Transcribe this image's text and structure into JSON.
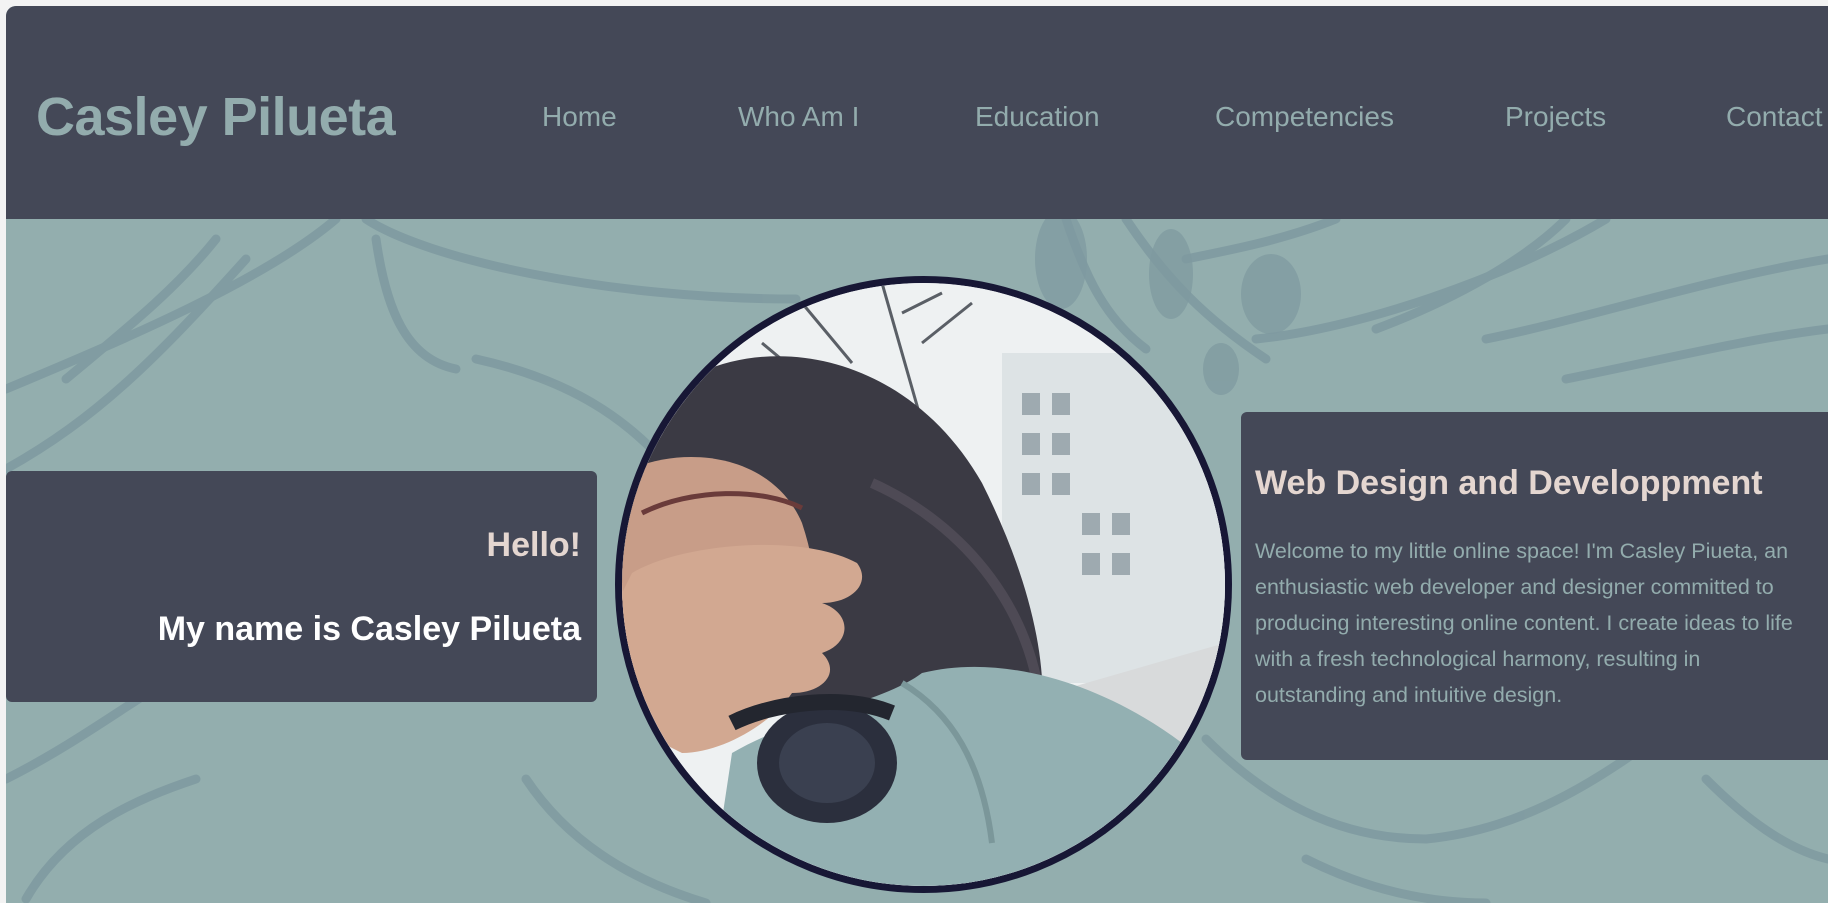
{
  "header": {
    "brand": "Casley Pilueta",
    "nav": [
      {
        "label": "Home"
      },
      {
        "label": "Who Am I"
      },
      {
        "label": "Education"
      },
      {
        "label": "Competencies"
      },
      {
        "label": "Projects"
      },
      {
        "label": "Contact"
      }
    ]
  },
  "hero": {
    "greeting": "Hello!",
    "name_line": "My name is Casley Pilueta",
    "portrait": "profile-photo",
    "info": {
      "title": "Web Design and Developpment",
      "body": "Welcome to my little online space! I'm Casley Piueta, an enthusiastic web developer and designer committed to producing interesting online content. I create ideas to life with a fresh technological harmony, resulting in outstanding and intuitive design."
    }
  },
  "colors": {
    "header_bg": "#444857",
    "page_bg": "#93aeae",
    "accent_text": "#93acad",
    "heading_text": "#e4d6d0",
    "portrait_border": "#171735"
  }
}
